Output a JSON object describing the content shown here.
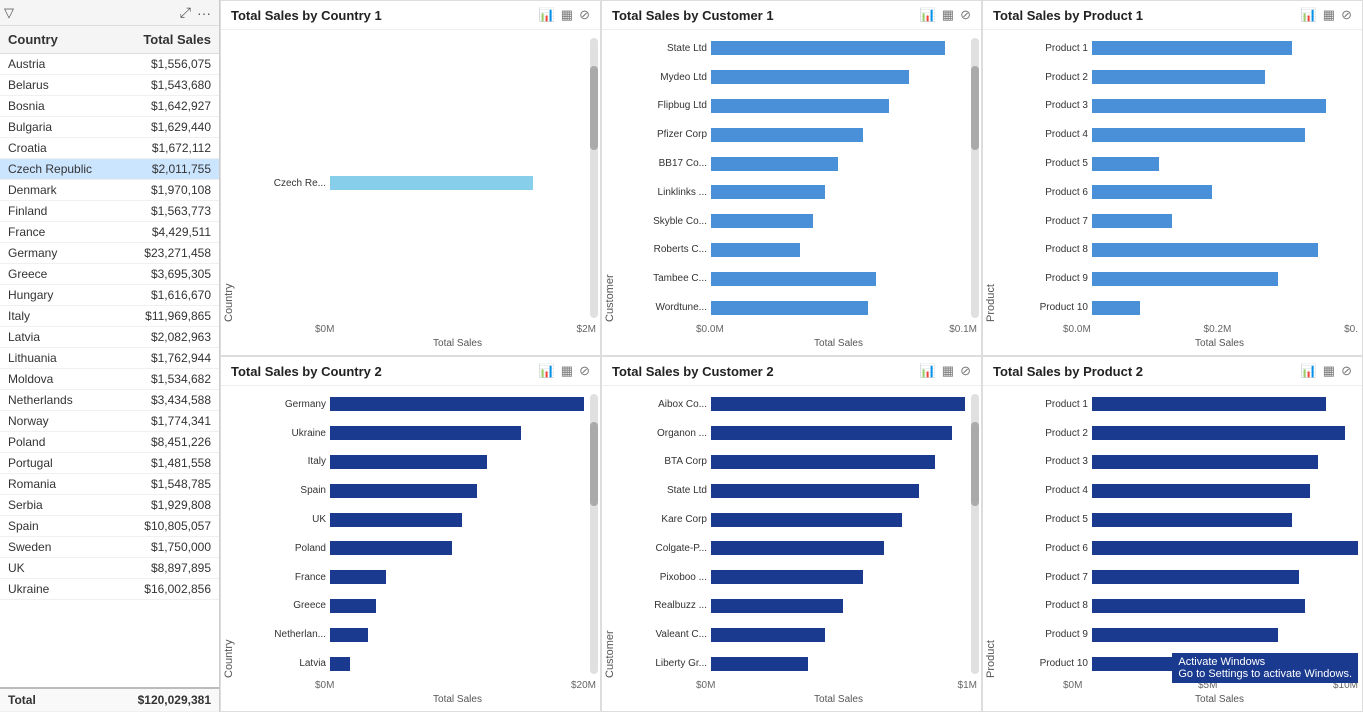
{
  "toolbar": {
    "filter_icon": "▽",
    "expand_icon": "⤢",
    "more_icon": "···"
  },
  "table": {
    "title": "Country Total Sales",
    "col_country": "Country",
    "col_sales": "Total Sales",
    "rows": [
      {
        "country": "Austria",
        "sales": "$1,556,075",
        "selected": false
      },
      {
        "country": "Belarus",
        "sales": "$1,543,680",
        "selected": false
      },
      {
        "country": "Bosnia",
        "sales": "$1,642,927",
        "selected": false
      },
      {
        "country": "Bulgaria",
        "sales": "$1,629,440",
        "selected": false
      },
      {
        "country": "Croatia",
        "sales": "$1,672,112",
        "selected": false
      },
      {
        "country": "Czech Republic",
        "sales": "$2,011,755",
        "selected": true
      },
      {
        "country": "Denmark",
        "sales": "$1,970,108",
        "selected": false
      },
      {
        "country": "Finland",
        "sales": "$1,563,773",
        "selected": false
      },
      {
        "country": "France",
        "sales": "$4,429,511",
        "selected": false
      },
      {
        "country": "Germany",
        "sales": "$23,271,458",
        "selected": false
      },
      {
        "country": "Greece",
        "sales": "$3,695,305",
        "selected": false
      },
      {
        "country": "Hungary",
        "sales": "$1,616,670",
        "selected": false
      },
      {
        "country": "Italy",
        "sales": "$11,969,865",
        "selected": false
      },
      {
        "country": "Latvia",
        "sales": "$2,082,963",
        "selected": false
      },
      {
        "country": "Lithuania",
        "sales": "$1,762,944",
        "selected": false
      },
      {
        "country": "Moldova",
        "sales": "$1,534,682",
        "selected": false
      },
      {
        "country": "Netherlands",
        "sales": "$3,434,588",
        "selected": false
      },
      {
        "country": "Norway",
        "sales": "$1,774,341",
        "selected": false
      },
      {
        "country": "Poland",
        "sales": "$8,451,226",
        "selected": false
      },
      {
        "country": "Portugal",
        "sales": "$1,481,558",
        "selected": false
      },
      {
        "country": "Romania",
        "sales": "$1,548,785",
        "selected": false
      },
      {
        "country": "Serbia",
        "sales": "$1,929,808",
        "selected": false
      },
      {
        "country": "Spain",
        "sales": "$10,805,057",
        "selected": false
      },
      {
        "country": "Sweden",
        "sales": "$1,750,000",
        "selected": false
      },
      {
        "country": "UK",
        "sales": "$8,897,895",
        "selected": false
      },
      {
        "country": "Ukraine",
        "sales": "$16,002,856",
        "selected": false
      }
    ],
    "total_label": "Total",
    "total_sales": "$120,029,381"
  },
  "charts": {
    "country1": {
      "title": "Total Sales by Country 1",
      "y_label": "Country",
      "x_label": "Total Sales",
      "bars": [
        {
          "label": "Czech Re...",
          "pct": 100,
          "highlight": true
        }
      ],
      "x_ticks": [
        "$0M",
        "$2M"
      ],
      "scrollbar": true
    },
    "customer1": {
      "title": "Total Sales by Customer 1",
      "y_label": "Customer",
      "x_label": "Total Sales",
      "bars": [
        {
          "label": "State Ltd",
          "pct": 92
        },
        {
          "label": "Mydeo Ltd",
          "pct": 78
        },
        {
          "label": "Flipbug Ltd",
          "pct": 70
        },
        {
          "label": "Pfizer Corp",
          "pct": 60
        },
        {
          "label": "BB17 Co...",
          "pct": 50
        },
        {
          "label": "Linklinks ...",
          "pct": 45
        },
        {
          "label": "Skyble Co...",
          "pct": 40
        },
        {
          "label": "Roberts C...",
          "pct": 35
        },
        {
          "label": "Tambee C...",
          "pct": 65
        },
        {
          "label": "Wordtune...",
          "pct": 62
        }
      ],
      "x_ticks": [
        "$0.0M",
        "$0.1M"
      ],
      "scrollbar": true
    },
    "product1": {
      "title": "Total Sales by Product 1",
      "y_label": "Product",
      "x_label": "Total Sales",
      "bars": [
        {
          "label": "Product 1",
          "pct": 75
        },
        {
          "label": "Product 2",
          "pct": 65
        },
        {
          "label": "Product 3",
          "pct": 88
        },
        {
          "label": "Product 4",
          "pct": 80
        },
        {
          "label": "Product 5",
          "pct": 25
        },
        {
          "label": "Product 6",
          "pct": 45
        },
        {
          "label": "Product 7",
          "pct": 30
        },
        {
          "label": "Product 8",
          "pct": 85
        },
        {
          "label": "Product 9",
          "pct": 70
        },
        {
          "label": "Product 10",
          "pct": 18
        }
      ],
      "x_ticks": [
        "$0.0M",
        "$0.2M",
        "$0."
      ],
      "scrollbar": false
    },
    "country2": {
      "title": "Total Sales by Country 2",
      "y_label": "Country",
      "x_label": "Total Sales",
      "bars": [
        {
          "label": "Germany",
          "pct": 100
        },
        {
          "label": "Ukraine",
          "pct": 75
        },
        {
          "label": "Italy",
          "pct": 62
        },
        {
          "label": "Spain",
          "pct": 58
        },
        {
          "label": "UK",
          "pct": 52
        },
        {
          "label": "Poland",
          "pct": 48
        },
        {
          "label": "France",
          "pct": 22
        },
        {
          "label": "Greece",
          "pct": 18
        },
        {
          "label": "Netherlan...",
          "pct": 15
        },
        {
          "label": "Latvia",
          "pct": 8
        }
      ],
      "x_ticks": [
        "$0M",
        "$20M"
      ],
      "scrollbar": true
    },
    "customer2": {
      "title": "Total Sales by Customer 2",
      "y_label": "Customer",
      "x_label": "Total Sales",
      "bars": [
        {
          "label": "Aibox Co...",
          "pct": 100
        },
        {
          "label": "Organon ...",
          "pct": 95
        },
        {
          "label": "BTA Corp",
          "pct": 88
        },
        {
          "label": "State Ltd",
          "pct": 82
        },
        {
          "label": "Kare Corp",
          "pct": 75
        },
        {
          "label": "Colgate-P...",
          "pct": 68
        },
        {
          "label": "Pixoboo ...",
          "pct": 60
        },
        {
          "label": "Realbuzz ...",
          "pct": 52
        },
        {
          "label": "Valeant C...",
          "pct": 45
        },
        {
          "label": "Liberty Gr...",
          "pct": 38
        }
      ],
      "x_ticks": [
        "$0M",
        "$1M"
      ],
      "scrollbar": true
    },
    "product2": {
      "title": "Total Sales by Product 2",
      "y_label": "Product",
      "x_label": "Total Sales",
      "bars": [
        {
          "label": "Product 1",
          "pct": 88
        },
        {
          "label": "Product 2",
          "pct": 95
        },
        {
          "label": "Product 3",
          "pct": 85
        },
        {
          "label": "Product 4",
          "pct": 82
        },
        {
          "label": "Product 5",
          "pct": 75
        },
        {
          "label": "Product 6",
          "pct": 100
        },
        {
          "label": "Product 7",
          "pct": 78
        },
        {
          "label": "Product 8",
          "pct": 80
        },
        {
          "label": "Product 9",
          "pct": 70
        },
        {
          "label": "Product 10",
          "pct": 60
        }
      ],
      "x_ticks": [
        "$0M",
        "$5M",
        "$10M"
      ],
      "scrollbar": false
    }
  }
}
